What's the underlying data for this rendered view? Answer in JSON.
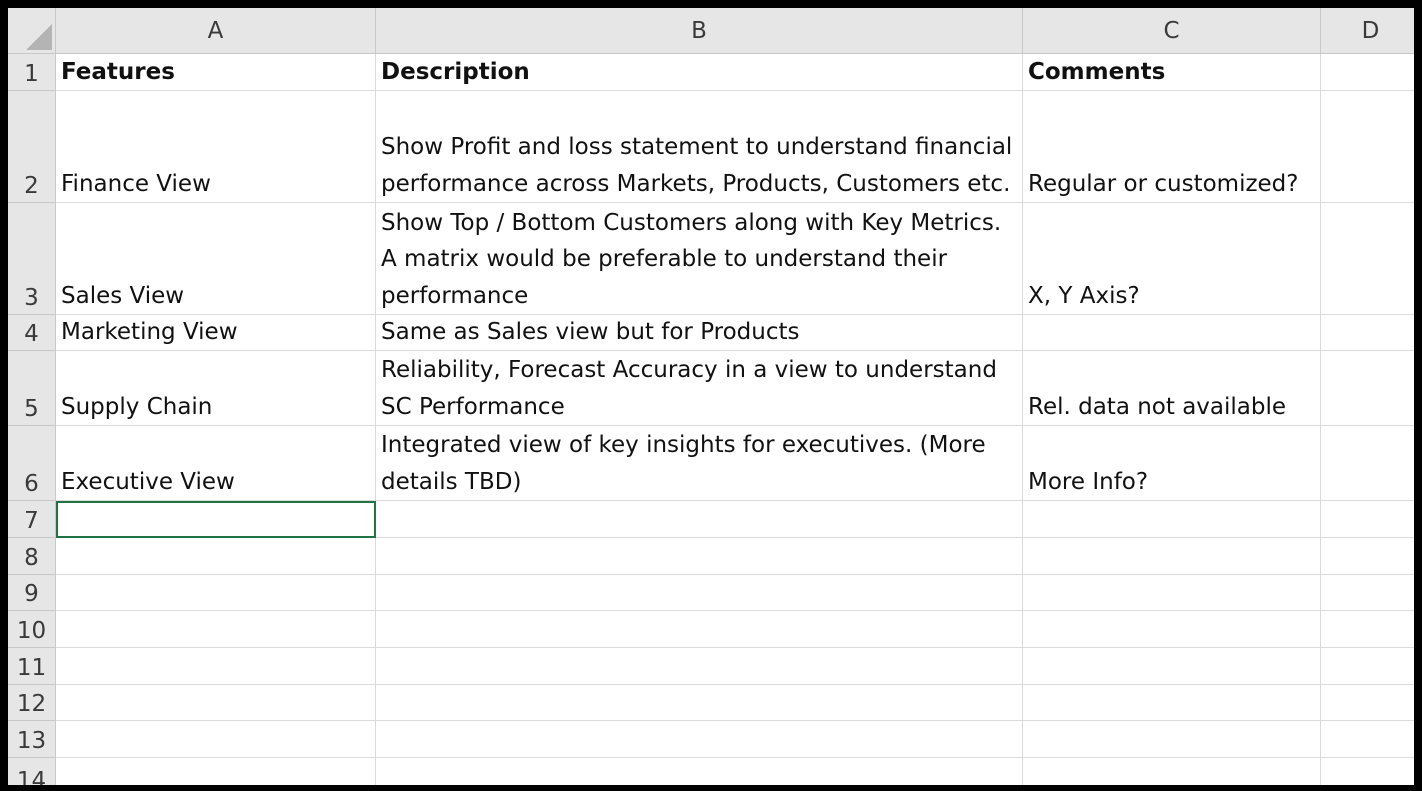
{
  "columns": [
    "A",
    "B",
    "C",
    "D"
  ],
  "rows": [
    "1",
    "2",
    "3",
    "4",
    "5",
    "6",
    "7",
    "8",
    "9",
    "10",
    "11",
    "12",
    "13",
    "14"
  ],
  "grid": [
    [
      "Features",
      "Description",
      "Comments",
      ""
    ],
    [
      "Finance View",
      "Show Profit and loss statement to understand financial\nperformance across Markets, Products, Customers etc.",
      "Regular or customized?",
      ""
    ],
    [
      "Sales View",
      "Show Top / Bottom Customers along with Key Metrics.\nA matrix would be preferable to understand their\nperformance",
      "X, Y Axis?",
      ""
    ],
    [
      "Marketing View",
      "Same as Sales view but for Products",
      "",
      ""
    ],
    [
      "Supply Chain",
      "Reliability, Forecast Accuracy in a view to understand\nSC Performance",
      "Rel. data not available",
      ""
    ],
    [
      "Executive View",
      "Integrated view of key insights for executives. (More\ndetails TBD)",
      "More Info?",
      ""
    ],
    [
      "",
      "",
      "",
      ""
    ],
    [
      "",
      "",
      "",
      ""
    ],
    [
      "",
      "",
      "",
      ""
    ],
    [
      "",
      "",
      "",
      ""
    ],
    [
      "",
      "",
      "",
      ""
    ],
    [
      "",
      "",
      "",
      ""
    ],
    [
      "",
      "",
      "",
      ""
    ],
    [
      "",
      "",
      "",
      ""
    ]
  ],
  "header_row_bold": true,
  "selected_cell": "A7",
  "colors": {
    "grid_line": "#dadada",
    "header_bg": "#e6e6e6",
    "selection": "#217346"
  }
}
